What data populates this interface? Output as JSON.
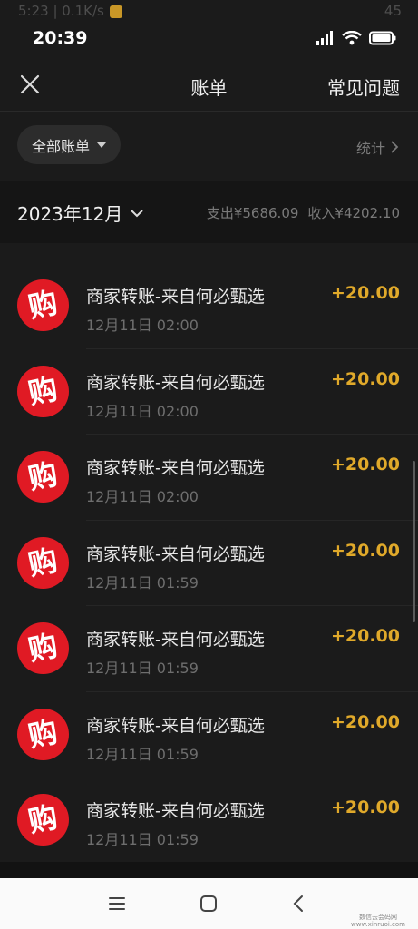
{
  "ghost_status": {
    "left": "5:23 | 0.1K/s",
    "right": "45"
  },
  "status": {
    "time": "20:39"
  },
  "nav": {
    "title": "账单",
    "faq_label": "常见问题"
  },
  "filter": {
    "label": "全部账单",
    "stats_label": "统计"
  },
  "month": {
    "label": "2023年12月",
    "expense": "支出¥5686.09",
    "income": "收入¥4202.10"
  },
  "transactions": [
    {
      "title": "商家转账-来自何必甄选",
      "time": "12月11日 02:00",
      "amount": "+20.00",
      "icon": "shop-gou-icon"
    },
    {
      "title": "商家转账-来自何必甄选",
      "time": "12月11日 02:00",
      "amount": "+20.00",
      "icon": "shop-gou-icon"
    },
    {
      "title": "商家转账-来自何必甄选",
      "time": "12月11日 02:00",
      "amount": "+20.00",
      "icon": "shop-gou-icon"
    },
    {
      "title": "商家转账-来自何必甄选",
      "time": "12月11日 01:59",
      "amount": "+20.00",
      "icon": "shop-gou-icon"
    },
    {
      "title": "商家转账-来自何必甄选",
      "time": "12月11日 01:59",
      "amount": "+20.00",
      "icon": "shop-gou-icon"
    },
    {
      "title": "商家转账-来自何必甄选",
      "time": "12月11日 01:59",
      "amount": "+20.00",
      "icon": "shop-gou-icon"
    },
    {
      "title": "商家转账-来自何必甄选",
      "time": "12月11日 01:59",
      "amount": "+20.00",
      "icon": "shop-gou-icon"
    }
  ],
  "logo_glyph": "购",
  "watermark": {
    "line1": "数信云会码网",
    "line2": "www.xinruoi.com"
  },
  "colors": {
    "amount": "#e0a92a",
    "logo_bg": "#e01a24",
    "background": "#1b1b1b"
  }
}
